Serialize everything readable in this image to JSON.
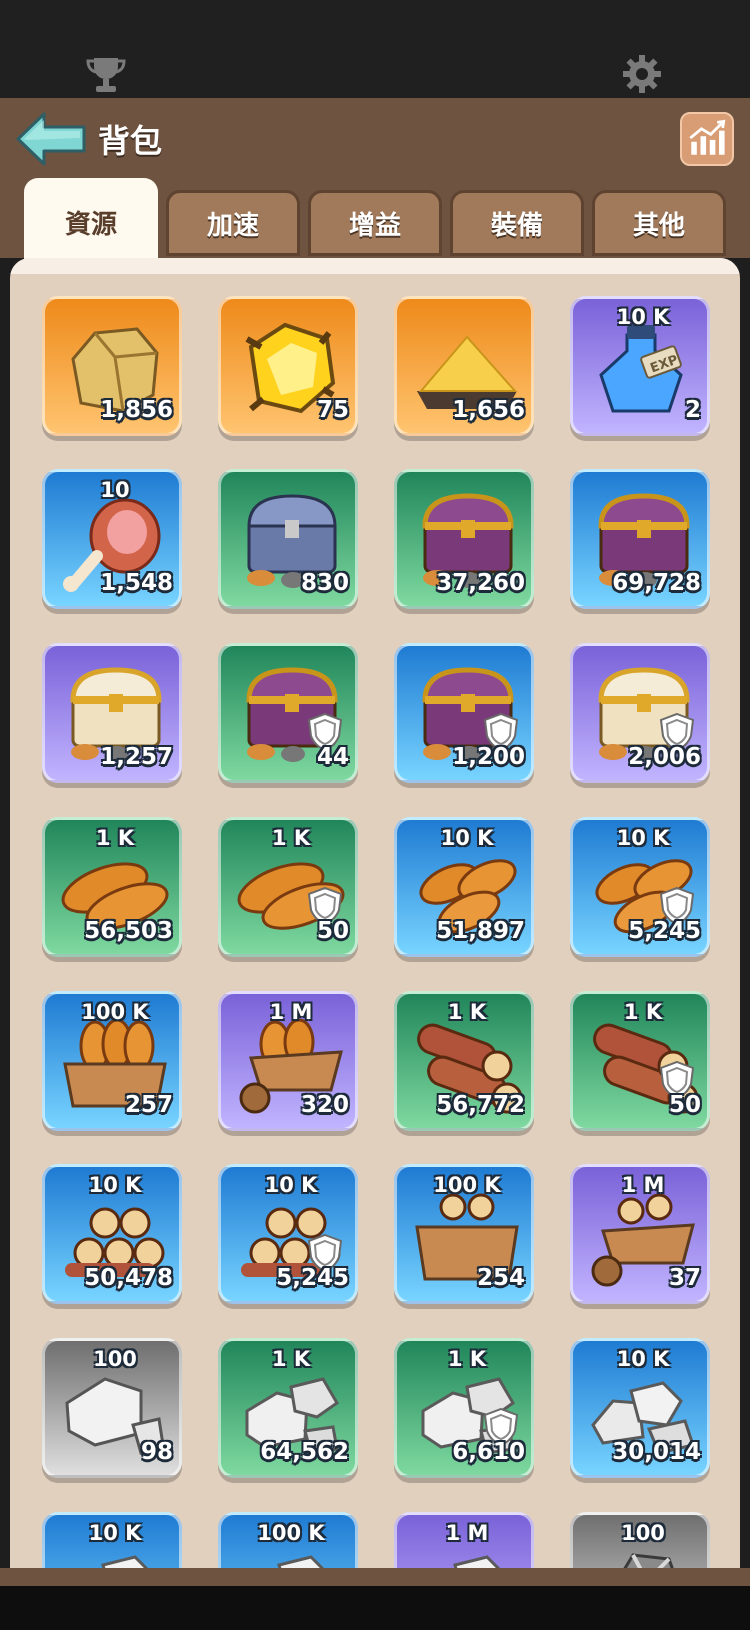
{
  "page": {
    "title": "背包"
  },
  "tabs": [
    {
      "label": "資源",
      "active": true
    },
    {
      "label": "加速",
      "active": false
    },
    {
      "label": "增益",
      "active": false
    },
    {
      "label": "裝備",
      "active": false
    },
    {
      "label": "其他",
      "active": false
    }
  ],
  "icons": {
    "status_left": "trophy-icon",
    "status_right": "gear-icon",
    "back": "back-arrow-icon",
    "stats": "bar-chart-icon"
  },
  "colors": {
    "orange": "#f39a2a",
    "purple": "#8d7ae6",
    "blue": "#2e8fe0",
    "green": "#2fa36a",
    "gray": "#9a9a9a",
    "header": "#6e5340"
  },
  "items": [
    {
      "name": "gold-ore",
      "rarity": "orange",
      "top": "",
      "count": "1,856",
      "shield": false,
      "icon": "gold-ore-icon"
    },
    {
      "name": "gold-crystal",
      "rarity": "orange",
      "top": "",
      "count": "75",
      "shield": false,
      "icon": "gold-crystal-icon"
    },
    {
      "name": "gold-dust",
      "rarity": "orange",
      "top": "",
      "count": "1,656",
      "shield": false,
      "icon": "gold-dust-icon"
    },
    {
      "name": "exp-potion",
      "rarity": "purple",
      "top": "10 K",
      "count": "2",
      "shield": false,
      "icon": "exp-potion-icon"
    },
    {
      "name": "meat",
      "rarity": "blue",
      "top": "10",
      "count": "1,548",
      "shield": false,
      "icon": "meat-icon"
    },
    {
      "name": "chest",
      "rarity": "green",
      "top": "",
      "count": "830",
      "shield": false,
      "icon": "iron-chest-icon"
    },
    {
      "name": "chest",
      "rarity": "green",
      "top": "",
      "count": "37,260",
      "shield": false,
      "icon": "purple-chest-icon"
    },
    {
      "name": "chest",
      "rarity": "blue",
      "top": "",
      "count": "69,728",
      "shield": false,
      "icon": "purple-chest-icon"
    },
    {
      "name": "chest",
      "rarity": "purple",
      "top": "",
      "count": "1,257",
      "shield": false,
      "icon": "gold-chest-icon"
    },
    {
      "name": "chest",
      "rarity": "green",
      "top": "",
      "count": "44",
      "shield": true,
      "icon": "purple-chest-icon"
    },
    {
      "name": "chest",
      "rarity": "blue",
      "top": "",
      "count": "1,200",
      "shield": true,
      "icon": "purple-chest-icon"
    },
    {
      "name": "chest",
      "rarity": "purple",
      "top": "",
      "count": "2,006",
      "shield": true,
      "icon": "gold-chest-icon"
    },
    {
      "name": "bread",
      "rarity": "green",
      "top": "1 K",
      "count": "56,503",
      "shield": false,
      "icon": "bread-icon"
    },
    {
      "name": "bread",
      "rarity": "green",
      "top": "1 K",
      "count": "50",
      "shield": true,
      "icon": "bread-icon"
    },
    {
      "name": "bread",
      "rarity": "blue",
      "top": "10 K",
      "count": "51,897",
      "shield": false,
      "icon": "bread-pile-icon"
    },
    {
      "name": "bread",
      "rarity": "blue",
      "top": "10 K",
      "count": "5,245",
      "shield": true,
      "icon": "bread-pile-icon"
    },
    {
      "name": "bread",
      "rarity": "blue",
      "top": "100 K",
      "count": "257",
      "shield": false,
      "icon": "bread-crate-icon"
    },
    {
      "name": "bread",
      "rarity": "purple",
      "top": "1 M",
      "count": "320",
      "shield": false,
      "icon": "bread-cart-icon"
    },
    {
      "name": "wood",
      "rarity": "green",
      "top": "1 K",
      "count": "56,772",
      "shield": false,
      "icon": "logs-icon"
    },
    {
      "name": "wood",
      "rarity": "green",
      "top": "1 K",
      "count": "50",
      "shield": true,
      "icon": "logs-icon"
    },
    {
      "name": "wood",
      "rarity": "blue",
      "top": "10 K",
      "count": "50,478",
      "shield": false,
      "icon": "log-pile-icon"
    },
    {
      "name": "wood",
      "rarity": "blue",
      "top": "10 K",
      "count": "5,245",
      "shield": true,
      "icon": "log-pile-icon"
    },
    {
      "name": "wood",
      "rarity": "blue",
      "top": "100 K",
      "count": "254",
      "shield": false,
      "icon": "log-crate-icon"
    },
    {
      "name": "wood",
      "rarity": "purple",
      "top": "1 M",
      "count": "37",
      "shield": false,
      "icon": "log-cart-icon"
    },
    {
      "name": "stone",
      "rarity": "gray",
      "top": "100",
      "count": "98",
      "shield": false,
      "icon": "stone-icon"
    },
    {
      "name": "stone",
      "rarity": "green",
      "top": "1 K",
      "count": "64,562",
      "shield": false,
      "icon": "stones-icon"
    },
    {
      "name": "stone",
      "rarity": "green",
      "top": "1 K",
      "count": "6,610",
      "shield": true,
      "icon": "stones-icon"
    },
    {
      "name": "stone",
      "rarity": "blue",
      "top": "10 K",
      "count": "30,014",
      "shield": false,
      "icon": "stone-pile-icon"
    },
    {
      "name": "stone",
      "rarity": "blue",
      "top": "10 K",
      "count": "",
      "shield": false,
      "icon": "stone-pile-icon"
    },
    {
      "name": "stone",
      "rarity": "blue",
      "top": "100 K",
      "count": "",
      "shield": false,
      "icon": "stone-pile-icon"
    },
    {
      "name": "stone",
      "rarity": "purple",
      "top": "1 M",
      "count": "",
      "shield": false,
      "icon": "stone-pile-icon"
    },
    {
      "name": "iron",
      "rarity": "gray",
      "top": "100",
      "count": "",
      "shield": false,
      "icon": "iron-ore-icon"
    }
  ]
}
